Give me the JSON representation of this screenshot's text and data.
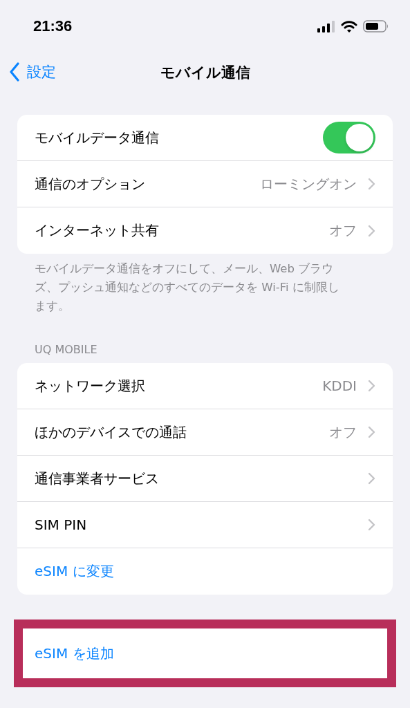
{
  "status_bar": {
    "time": "21:36"
  },
  "nav": {
    "back": "設定",
    "title": "モバイル通信"
  },
  "groups": [
    {
      "rows": [
        {
          "kind": "toggle",
          "label": "モバイルデータ通信",
          "on": true
        },
        {
          "kind": "detail",
          "label": "通信のオプション",
          "value": "ローミングオン"
        },
        {
          "kind": "detail",
          "label": "インターネット共有",
          "value": "オフ"
        }
      ],
      "footer": "モバイルデータ通信をオフにして、メール、Web ブラウズ、プッシュ通知などのすべてのデータを Wi-Fi に制限します。",
      "highlighted": false
    },
    {
      "header": "UQ MOBILE",
      "rows": [
        {
          "kind": "detail",
          "label": "ネットワーク選択",
          "value": "KDDI"
        },
        {
          "kind": "detail",
          "label": "ほかのデバイスでの通話",
          "value": "オフ"
        },
        {
          "kind": "detail",
          "label": "通信事業者サービス"
        },
        {
          "kind": "detail",
          "label": "SIM PIN"
        },
        {
          "kind": "link",
          "label": "eSIM に変更"
        }
      ],
      "highlighted": false
    },
    {
      "rows": [
        {
          "kind": "link",
          "label": "eSIM を追加"
        }
      ],
      "highlighted": true
    }
  ]
}
